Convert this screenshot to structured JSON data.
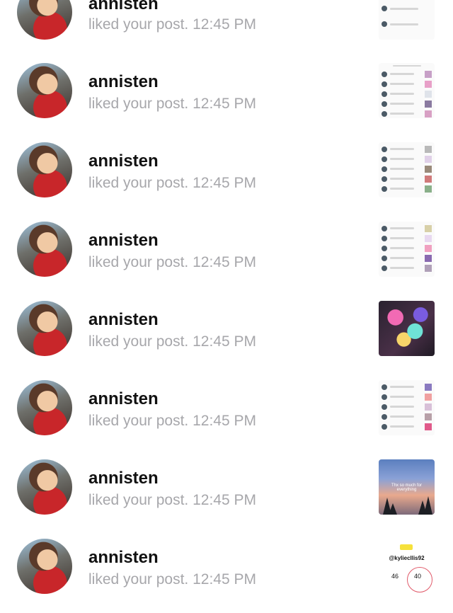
{
  "notifications": [
    {
      "username": "annisten",
      "text": "liked your post.",
      "time": "12:45 PM",
      "thumbnail": "app-list-screenshot"
    },
    {
      "username": "annisten",
      "text": "liked your post.",
      "time": "12:45 PM",
      "thumbnail": "app-list-screenshot"
    },
    {
      "username": "annisten",
      "text": "liked your post.",
      "time": "12:45 PM",
      "thumbnail": "app-list-screenshot"
    },
    {
      "username": "annisten",
      "text": "liked your post.",
      "time": "12:45 PM",
      "thumbnail": "app-list-screenshot"
    },
    {
      "username": "annisten",
      "text": "liked your post.",
      "time": "12:45 PM",
      "thumbnail": "fabric-photo"
    },
    {
      "username": "annisten",
      "text": "liked your post.",
      "time": "12:45 PM",
      "thumbnail": "app-list-screenshot"
    },
    {
      "username": "annisten",
      "text": "liked your post.",
      "time": "12:45 PM",
      "thumbnail": "sunset-sky-photo",
      "thumbnail_caption": "Thx so much for everything"
    },
    {
      "username": "annisten",
      "text": "liked your post.",
      "time": "12:45 PM",
      "thumbnail": "profile-screenshot",
      "thumbnail_handle": "@kyliecllis92",
      "thumbnail_stats": [
        "46",
        "40"
      ]
    }
  ],
  "colors": {
    "name": "#111111",
    "secondary": "#a7a7ab",
    "background": "#ffffff"
  }
}
